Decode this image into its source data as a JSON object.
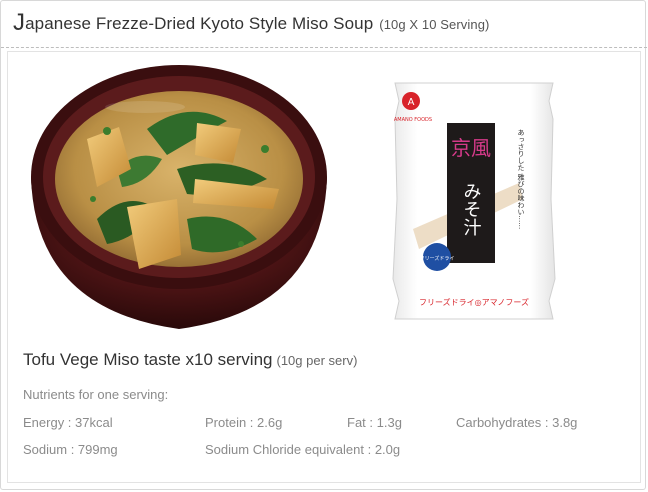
{
  "header": {
    "title_initial": "J",
    "title_rest": "apanese Frezze-Dried Kyoto Style Miso Soup",
    "title_sub": "(10g X 10 Serving)"
  },
  "product": {
    "name": "Tofu Vege Miso taste x10 serving",
    "name_sub": "(10g per serv)"
  },
  "package": {
    "brand": "AMANO FOODS",
    "tagline": "あっさりした 雅びの味わい……",
    "name_top": "京風",
    "name_bottom": "みそ汁",
    "badge": "フリーズドライ",
    "footer": "フリーズドライ◎アマノフーズ"
  },
  "nutrients": {
    "heading": "Nutrients for one serving:",
    "energy": "Energy : 37kcal",
    "protein": "Protein : 2.6g",
    "fat": "Fat : 1.3g",
    "carbohydrates": "Carbohydrates : 3.8g",
    "sodium": "Sodium : 799mg",
    "sodium_chloride": "Sodium Chloride equivalent : 2.0g"
  }
}
